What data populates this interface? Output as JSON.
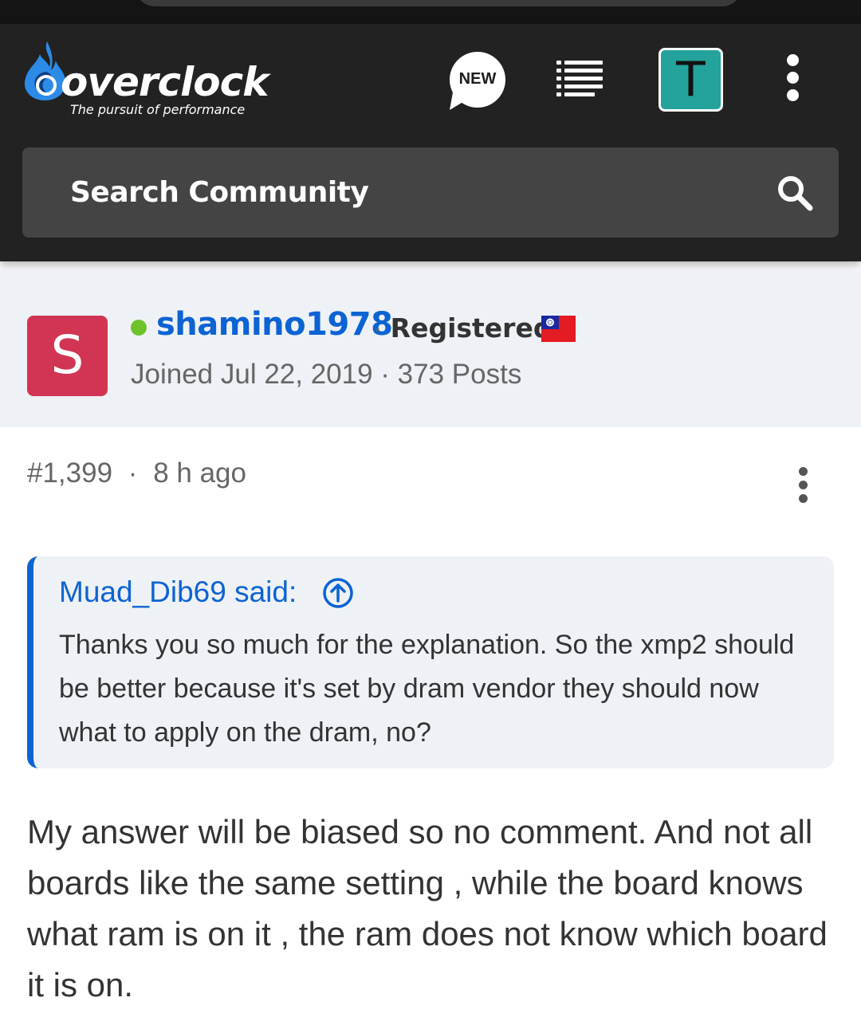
{
  "site": {
    "logo_word": "overclock",
    "tagline": "The pursuit of performance",
    "new_label": "NEW",
    "user_initial": "T"
  },
  "search": {
    "placeholder": "Search Community"
  },
  "author": {
    "initial": "S",
    "name": "shamino1978",
    "separator": "·",
    "role": "Registered",
    "flag_icon": "taiwan-flag-icon",
    "meta": "Joined Jul 22, 2019 · 373 Posts"
  },
  "post": {
    "number": "#1,399",
    "separator": "·",
    "time": "8 h ago",
    "quote": {
      "author_said": "Muad_Dib69 said:",
      "text": "Thanks you so much for the explanation. So the xmp2 should be better because it's set by dram vendor they should now what to apply on the dram, no?"
    },
    "body": "My answer will be biased so no comment. And not all boards like the same setting , while the board knows what ram is on it , the ram does not know which board it is on."
  },
  "colors": {
    "header_bg": "#222222",
    "search_bg": "#444444",
    "accent_blue": "#0c63d3",
    "author_bg": "#eef1f5",
    "avatar_s": "#d23553",
    "avatar_t": "#23a39b",
    "online": "#6fc22a"
  }
}
